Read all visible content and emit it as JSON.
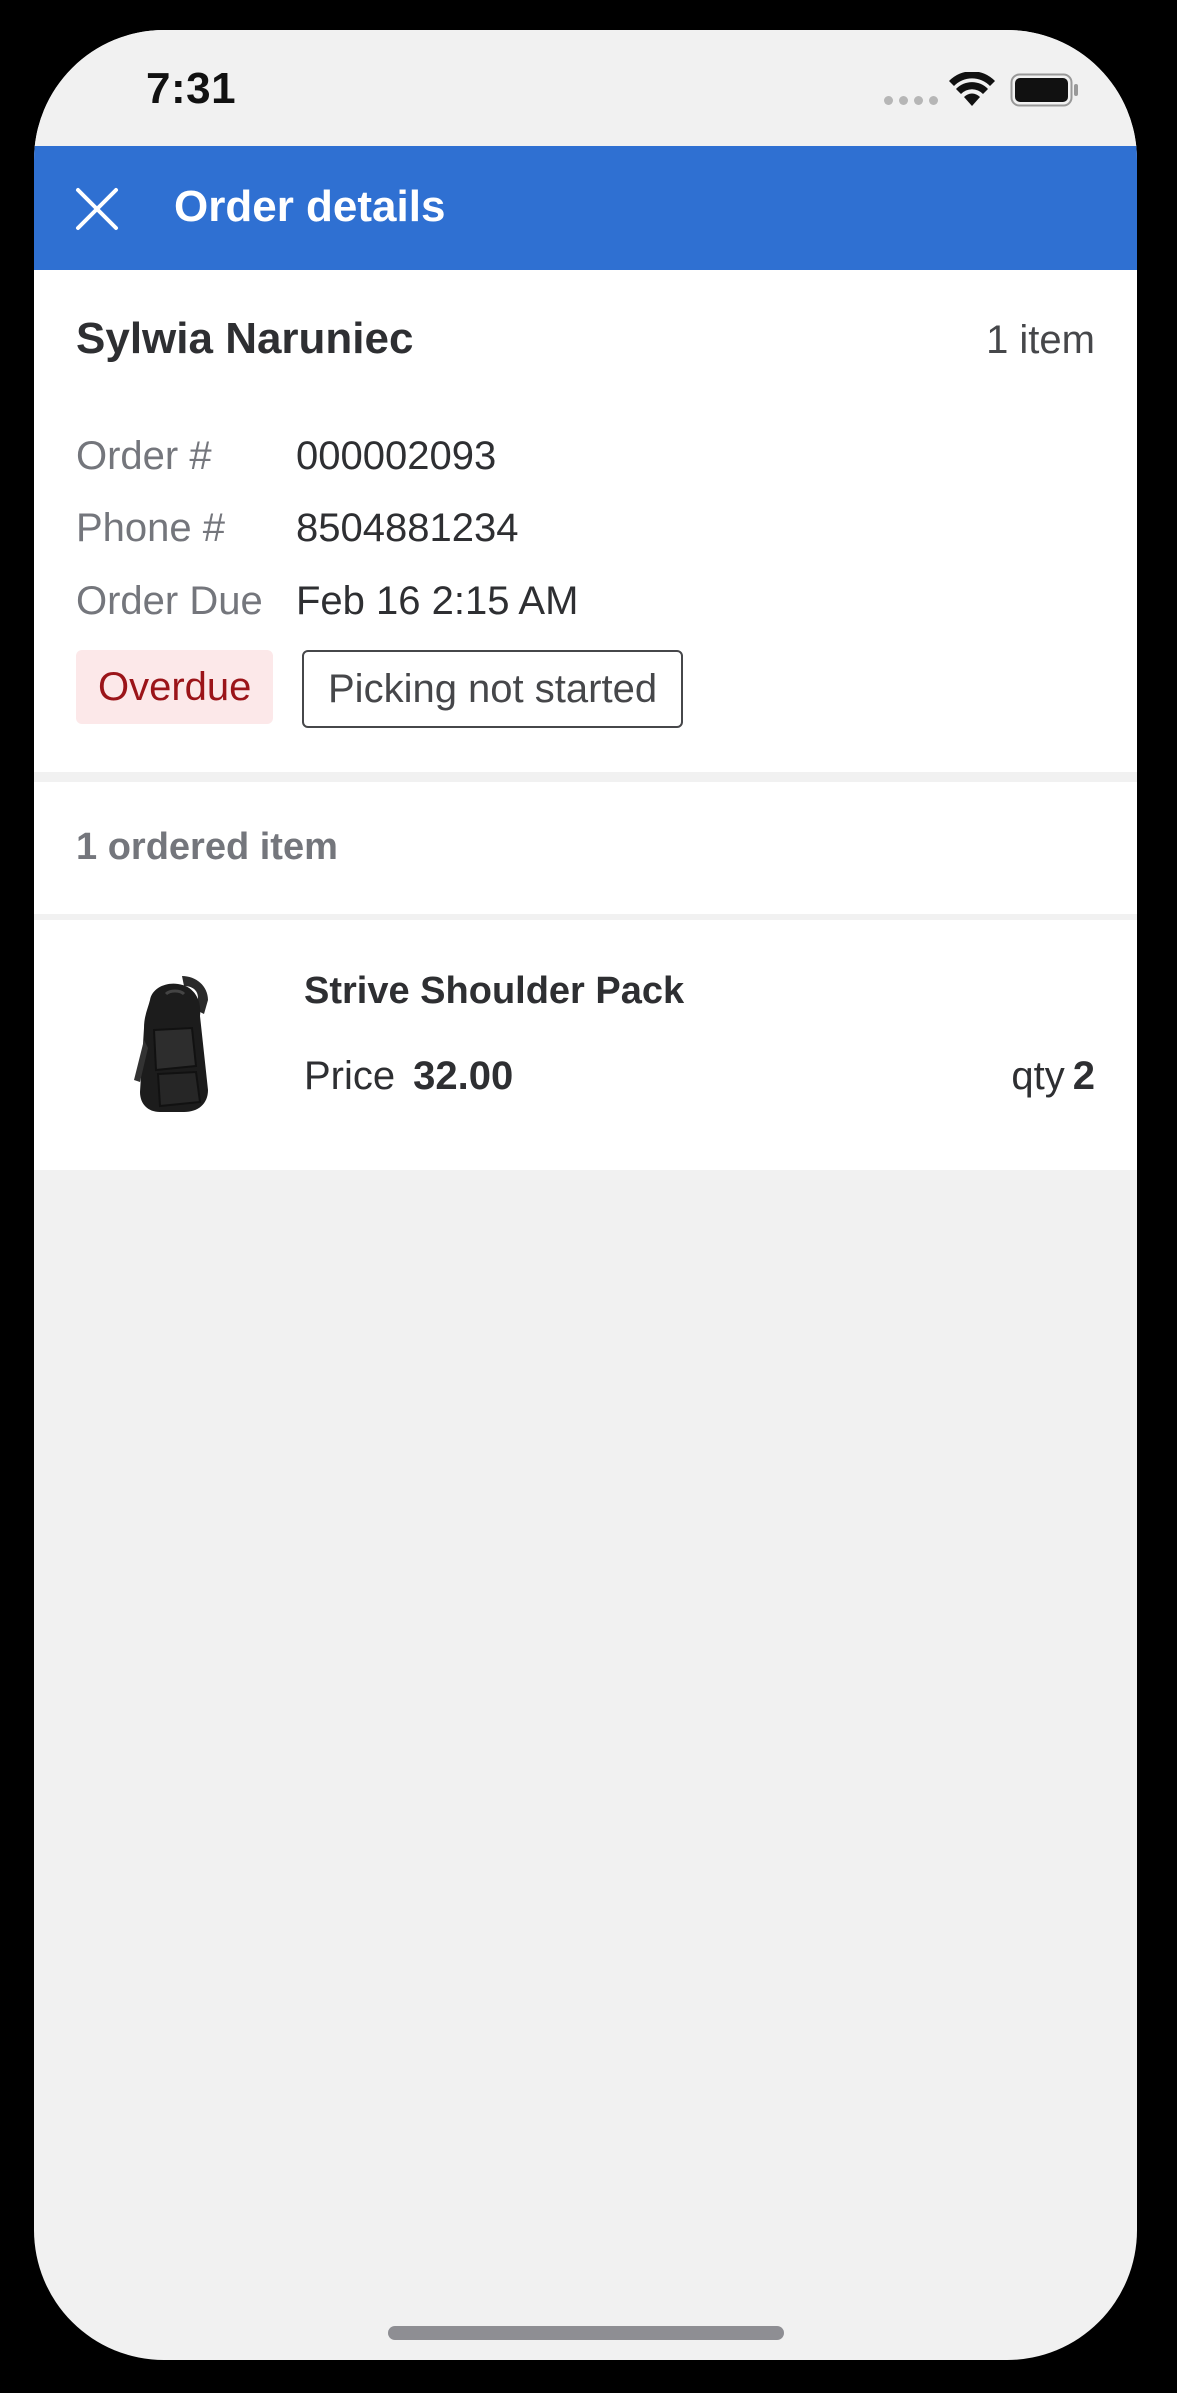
{
  "status_bar": {
    "time": "7:31",
    "icons": [
      "signal-dots-icon",
      "wifi-icon",
      "battery-icon"
    ]
  },
  "header": {
    "title": "Order details",
    "close_icon": "close-icon",
    "background_color": "#2f70d2"
  },
  "order": {
    "customer_name": "Sylwia Naruniec",
    "item_count": "1 item",
    "details": [
      {
        "label": "Order #",
        "value": "000002093"
      },
      {
        "label": "Phone #",
        "value": "8504881234"
      },
      {
        "label": "Order Due",
        "value": "Feb 16 2:15 AM"
      }
    ],
    "badges": {
      "overdue": "Overdue",
      "picking_status": "Picking not started"
    }
  },
  "items_section": {
    "title": "1 ordered item"
  },
  "items": [
    {
      "name": "Strive Shoulder Pack",
      "price_label": "Price",
      "price": "32.00",
      "qty_label": "qty",
      "qty": "2",
      "image_icon": "shoulder-pack-image"
    }
  ],
  "colors": {
    "accent": "#2f70d2",
    "overdue_text": "#9b1419",
    "overdue_bg": "#fce8e9",
    "page_background": "#f1f1f1"
  }
}
